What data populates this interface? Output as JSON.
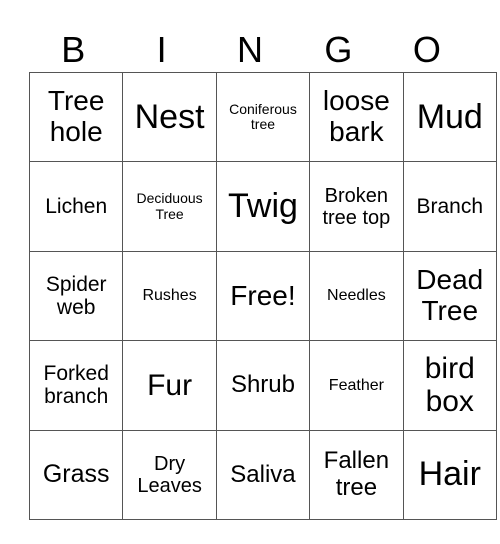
{
  "header": [
    "B",
    "I",
    "N",
    "G",
    "O"
  ],
  "cells": [
    [
      "Tree hole",
      "Nest",
      "Coniferous tree",
      "loose bark",
      "Mud"
    ],
    [
      "Lichen",
      "Deciduous Tree",
      "Twig",
      "Broken tree top",
      "Branch"
    ],
    [
      "Spider web",
      "Rushes",
      "Free!",
      "Needles",
      "Dead Tree"
    ],
    [
      "Forked branch",
      "Fur",
      "Shrub",
      "Feather",
      "bird box"
    ],
    [
      "Grass",
      "Dry Leaves",
      "Saliva",
      "Fallen tree",
      "Hair"
    ]
  ]
}
